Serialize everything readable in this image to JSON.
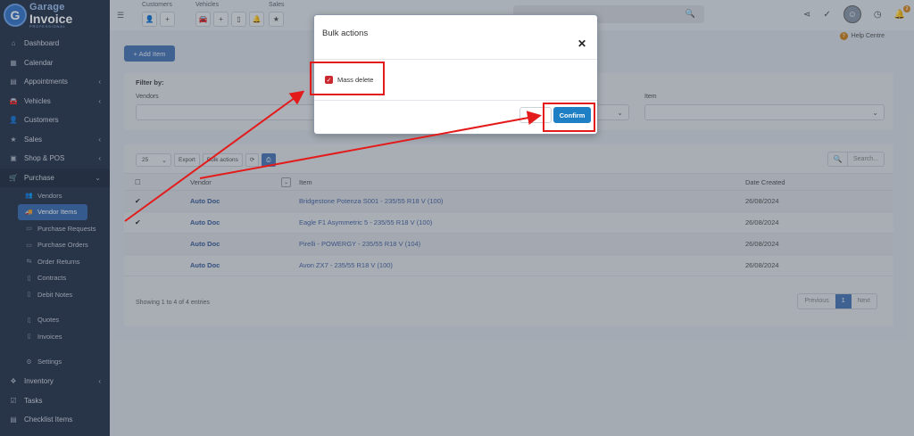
{
  "brand": {
    "line1": "Garage",
    "line2": "Invoice",
    "line3": "PROFESSIONAL",
    "logo_letter": "G"
  },
  "sidebar": {
    "items": [
      {
        "label": "Dashboard",
        "icon": "home-icon",
        "glyph": "⌂",
        "chevron": false
      },
      {
        "label": "Calendar",
        "icon": "calendar-icon",
        "glyph": "▦",
        "chevron": false
      },
      {
        "label": "Appointments",
        "icon": "calendar-check-icon",
        "glyph": "▤",
        "chevron": true
      },
      {
        "label": "Vehicles",
        "icon": "car-icon",
        "glyph": "🚘",
        "chevron": true
      },
      {
        "label": "Customers",
        "icon": "user-icon",
        "glyph": "👤",
        "chevron": false
      },
      {
        "label": "Sales",
        "icon": "star-icon",
        "glyph": "★",
        "chevron": true
      },
      {
        "label": "Shop & POS",
        "icon": "shop-icon",
        "glyph": "▣",
        "chevron": true
      }
    ],
    "purchase": {
      "label": "Purchase",
      "icon": "cart-icon",
      "glyph": "🛒"
    },
    "purchase_sub": [
      {
        "label": "Vendors",
        "icon": "users-icon",
        "glyph": "👥",
        "active": false
      },
      {
        "label": "Vendor Items",
        "icon": "truck-icon",
        "glyph": "🚚",
        "active": true
      },
      {
        "label": "Purchase Requests",
        "icon": "truck-icon",
        "glyph": "▭",
        "active": false
      },
      {
        "label": "Purchase Orders",
        "icon": "truck-icon",
        "glyph": "▭",
        "active": false
      },
      {
        "label": "Order Returns",
        "icon": "return-icon",
        "glyph": "⇆",
        "active": false
      },
      {
        "label": "Contracts",
        "icon": "file-icon",
        "glyph": "▯",
        "active": false
      },
      {
        "label": "Debit Notes",
        "icon": "file-icon",
        "glyph": "▯",
        "active": false
      }
    ],
    "purchase_sub2": [
      {
        "label": "Quotes",
        "icon": "file-icon",
        "glyph": "▯"
      },
      {
        "label": "Invoices",
        "icon": "file-icon",
        "glyph": "▯"
      }
    ],
    "settings": {
      "label": "Settings",
      "icon": "gear-icon",
      "glyph": "⚙"
    },
    "bottom_items": [
      {
        "label": "Inventory",
        "icon": "cube-icon",
        "glyph": "❖",
        "chevron": true
      },
      {
        "label": "Tasks",
        "icon": "tasks-icon",
        "glyph": "☑",
        "chevron": false
      },
      {
        "label": "Checklist Items",
        "icon": "list-icon",
        "glyph": "▤",
        "chevron": false
      }
    ]
  },
  "topbar": {
    "groups": [
      {
        "label": "Customers",
        "buttons": [
          "👤",
          "+"
        ]
      },
      {
        "label": "Vehicles",
        "buttons": [
          "🚘",
          "+",
          "▯",
          "🔔"
        ]
      },
      {
        "label": "Sales",
        "buttons": [
          "★"
        ]
      }
    ],
    "badge_count": "3"
  },
  "main": {
    "help_label": "Help Centre",
    "add_button": "+ Add Item",
    "filter": {
      "title": "Filter by:",
      "vendors_label": "Vendors",
      "item_label": "Item"
    },
    "table": {
      "page_size": "25",
      "export_label": "Export",
      "bulk_label": "Bulk actions",
      "search_placeholder": "Search...",
      "headers": {
        "vendor": "Vendor",
        "item": "Item",
        "date": "Date Created"
      },
      "rows": [
        {
          "checked": true,
          "vendor": "Auto Doc",
          "item": "Bridgestone Potenza S001 - 235/55 R18 V (100)",
          "date": "26/08/2024"
        },
        {
          "checked": true,
          "vendor": "Auto Doc",
          "item": "Eagle F1 Asymmetric 5 - 235/55 R18 V (100)",
          "date": "26/08/2024"
        },
        {
          "checked": false,
          "vendor": "Auto Doc",
          "item": "Pirelli - POWERGY - 235/55 R18 V (104)",
          "date": "26/08/2024"
        },
        {
          "checked": false,
          "vendor": "Auto Doc",
          "item": "Avon ZX7 - 235/55 R18 V (100)",
          "date": "26/08/2024"
        }
      ],
      "footer": "Showing 1 to 4 of 4 entries",
      "pager": {
        "prev": "Previous",
        "current": "1",
        "next": "Next"
      }
    }
  },
  "modal": {
    "title": "Bulk actions",
    "close_glyph": "✕",
    "mass_delete_label": "Mass delete",
    "confirm_label": "Confirm"
  },
  "colors": {
    "sidebar_bg": "#2d3a50",
    "accent": "#4d79b8",
    "confirm": "#1f7fc4",
    "annotation_red": "#e31b1b"
  }
}
